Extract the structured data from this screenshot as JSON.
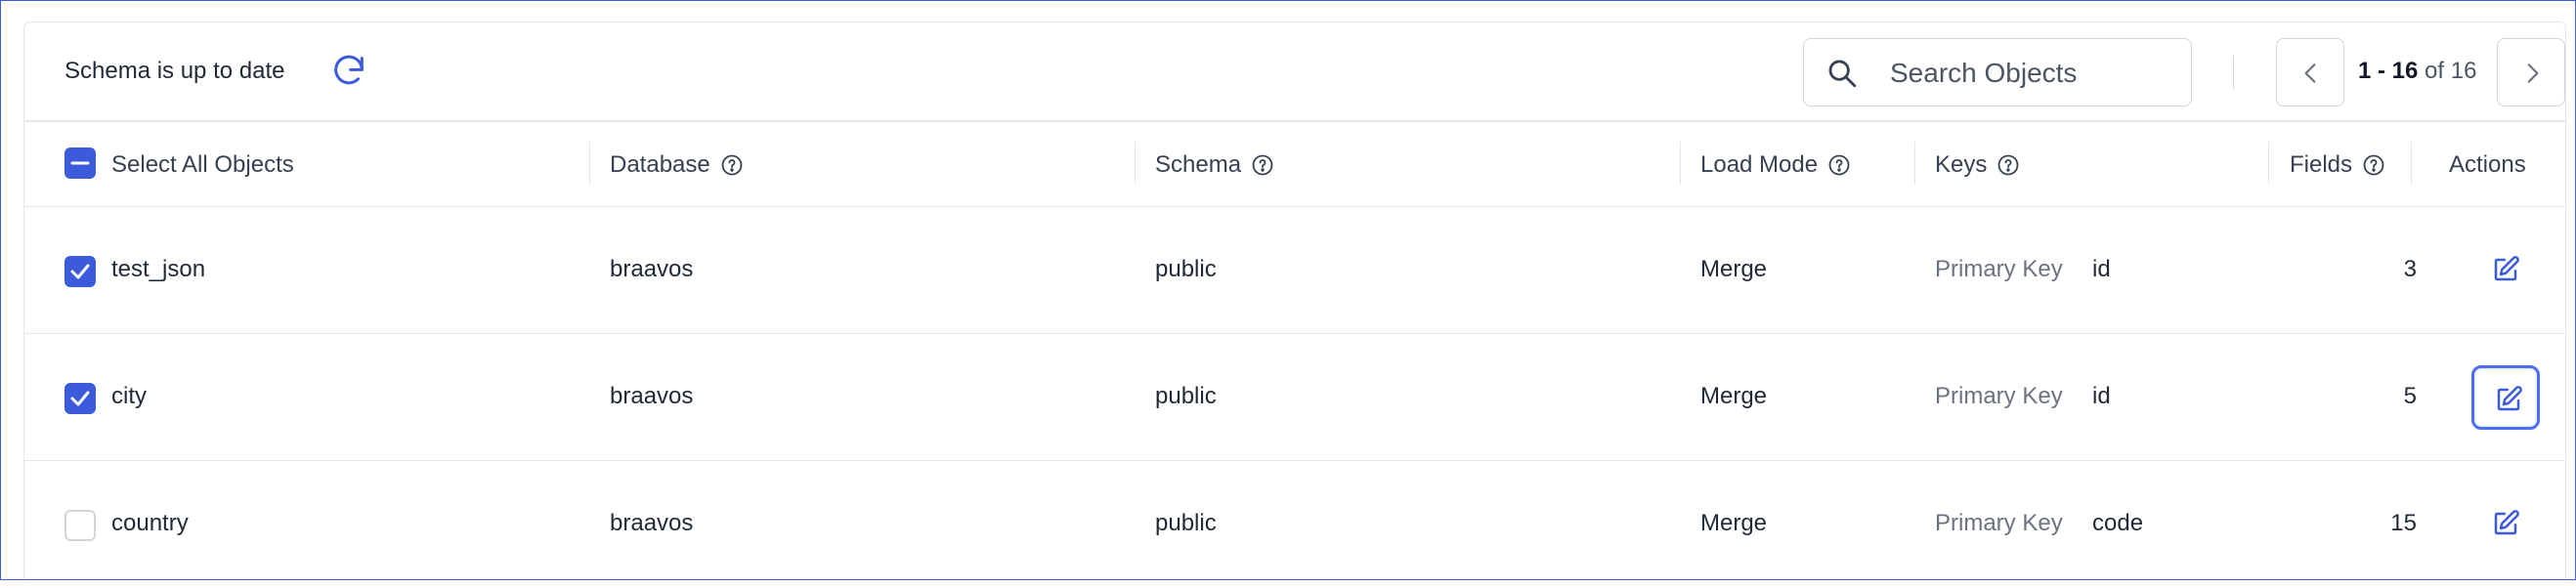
{
  "toolbar": {
    "status": "Schema is up to date",
    "search_placeholder": "Search Objects",
    "pagination": {
      "range": "1 - 16",
      "of_label": "of",
      "total": "16"
    }
  },
  "table": {
    "headers": {
      "select_all": "Select All Objects",
      "database": "Database",
      "schema": "Schema",
      "load_mode": "Load Mode",
      "keys": "Keys",
      "fields": "Fields",
      "actions": "Actions"
    },
    "rows": [
      {
        "name": "test_json",
        "database": "braavos",
        "schema": "public",
        "load_mode": "Merge",
        "key_type": "Primary Key",
        "key": "id",
        "fields": "3",
        "selected": true
      },
      {
        "name": "city",
        "database": "braavos",
        "schema": "public",
        "load_mode": "Merge",
        "key_type": "Primary Key",
        "key": "id",
        "fields": "5",
        "selected": true
      },
      {
        "name": "country",
        "database": "braavos",
        "schema": "public",
        "load_mode": "Merge",
        "key_type": "Primary Key",
        "key": "code",
        "fields": "15",
        "selected": false
      }
    ]
  },
  "colors": {
    "accent": "#3b5bdb",
    "border": "#e5e7eb",
    "focus": "#4c6ef5"
  },
  "icons": [
    "refresh-icon",
    "search-icon",
    "chevron-left-icon",
    "chevron-right-icon",
    "help-icon",
    "edit-icon",
    "check-icon",
    "minus-icon"
  ]
}
